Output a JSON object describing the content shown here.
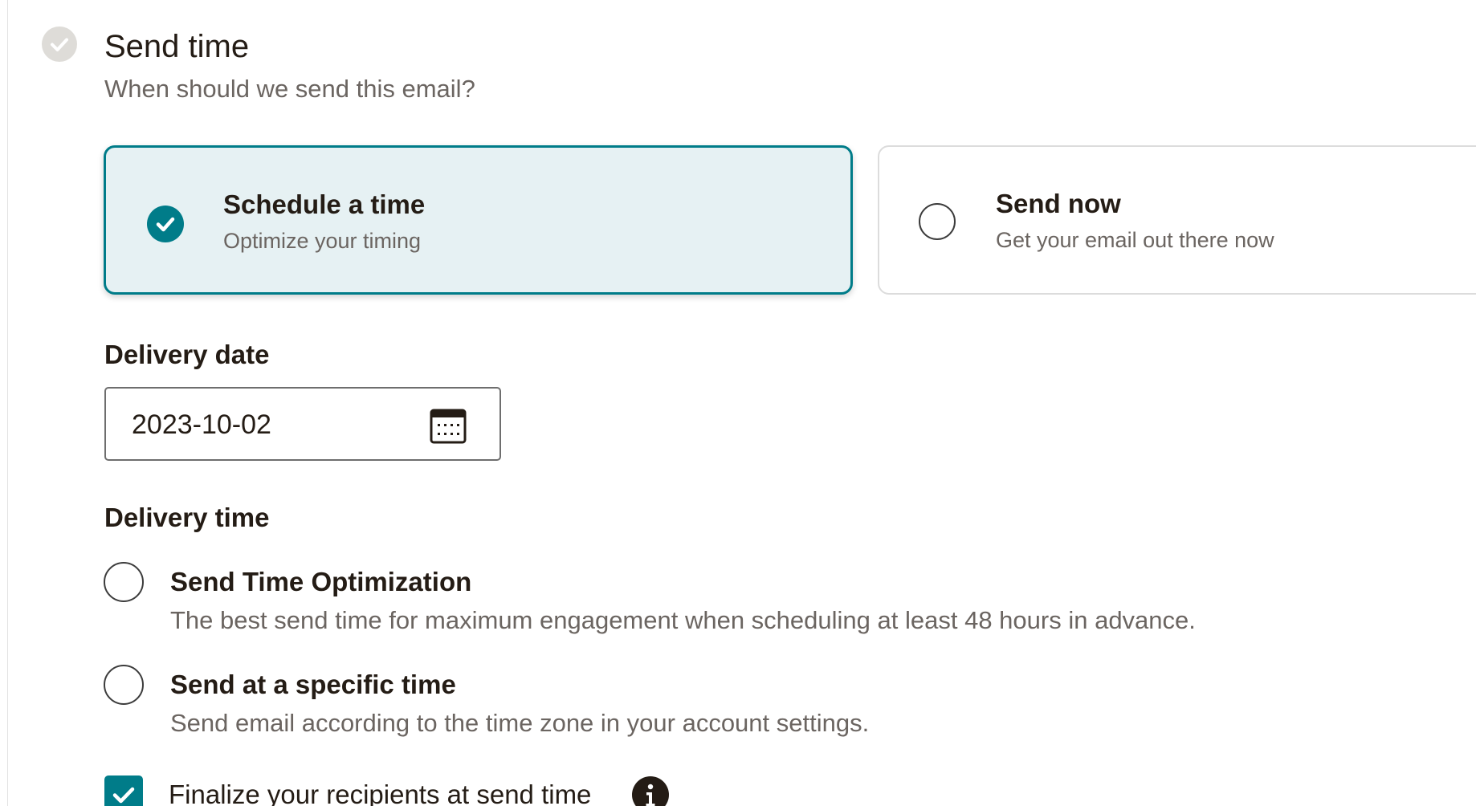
{
  "section": {
    "title": "Send time",
    "subtitle": "When should we send this email?"
  },
  "send_options": [
    {
      "title": "Schedule a time",
      "description": "Optimize your timing",
      "selected": true
    },
    {
      "title": "Send now",
      "description": "Get your email out there now",
      "selected": false
    }
  ],
  "delivery_date": {
    "label": "Delivery date",
    "value": "2023-10-02",
    "icon": "calendar-icon"
  },
  "delivery_time": {
    "label": "Delivery time",
    "options": [
      {
        "title": "Send Time Optimization",
        "description": "The best send time for maximum engagement when scheduling at least 48 hours in advance.",
        "selected": false
      },
      {
        "title": "Send at a specific time",
        "description": "Send email according to the time zone in your account settings.",
        "selected": false
      }
    ]
  },
  "finalize": {
    "label": "Finalize your recipients at send time",
    "checked": true,
    "info_icon": "info-icon"
  },
  "colors": {
    "accent": "#007c89",
    "selected_card_bg": "#e6f1f3",
    "text_primary": "#241c15",
    "text_secondary": "#6b6561"
  }
}
